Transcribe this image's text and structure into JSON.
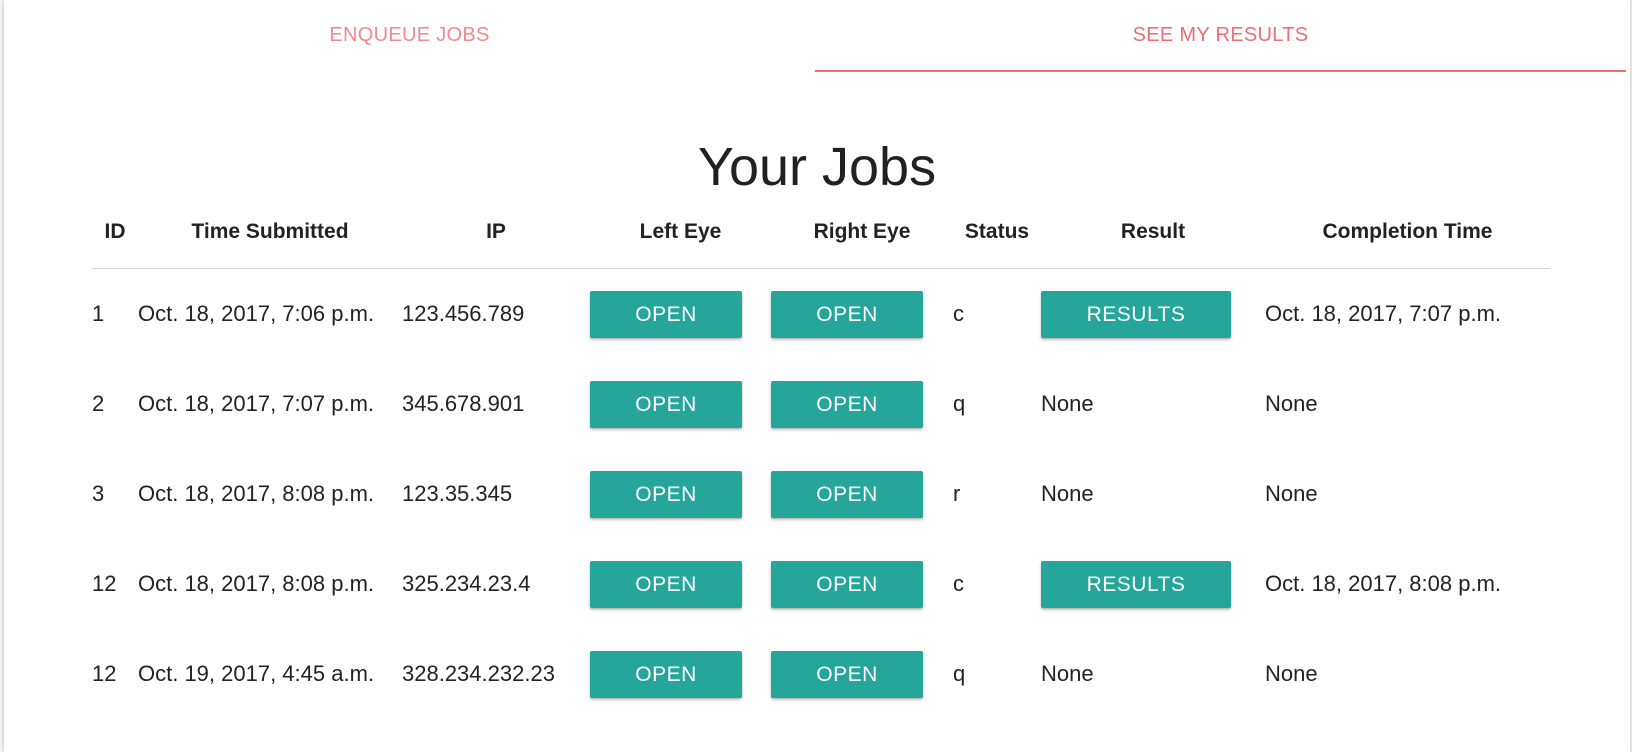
{
  "colors": {
    "accent": "#ee6e73",
    "button": "#26a69a"
  },
  "tabs": [
    {
      "label": "ENQUEUE JOBS",
      "active": false
    },
    {
      "label": "SEE MY RESULTS",
      "active": true
    }
  ],
  "page_title": "Your Jobs",
  "table": {
    "columns": [
      "ID",
      "Time Submitted",
      "IP",
      "Left Eye",
      "Right Eye",
      "Status",
      "Result",
      "Completion Time"
    ],
    "rows": [
      {
        "id": "1",
        "time_submitted": "Oct. 18, 2017, 7:06 p.m.",
        "ip": "123.456.789",
        "left_eye": "OPEN",
        "right_eye": "OPEN",
        "status": "c",
        "result": "RESULTS",
        "result_is_button": true,
        "completion_time": "Oct. 18, 2017, 7:07 p.m."
      },
      {
        "id": "2",
        "time_submitted": "Oct. 18, 2017, 7:07 p.m.",
        "ip": "345.678.901",
        "left_eye": "OPEN",
        "right_eye": "OPEN",
        "status": "q",
        "result": "None",
        "result_is_button": false,
        "completion_time": "None"
      },
      {
        "id": "3",
        "time_submitted": "Oct. 18, 2017, 8:08 p.m.",
        "ip": "123.35.345",
        "left_eye": "OPEN",
        "right_eye": "OPEN",
        "status": "r",
        "result": "None",
        "result_is_button": false,
        "completion_time": "None"
      },
      {
        "id": "12",
        "time_submitted": "Oct. 18, 2017, 8:08 p.m.",
        "ip": "325.234.23.4",
        "left_eye": "OPEN",
        "right_eye": "OPEN",
        "status": "c",
        "result": "RESULTS",
        "result_is_button": true,
        "completion_time": "Oct. 18, 2017, 8:08 p.m."
      },
      {
        "id": "12",
        "time_submitted": "Oct. 19, 2017, 4:45 a.m.",
        "ip": "328.234.232.23",
        "left_eye": "OPEN",
        "right_eye": "OPEN",
        "status": "q",
        "result": "None",
        "result_is_button": false,
        "completion_time": "None"
      }
    ]
  }
}
